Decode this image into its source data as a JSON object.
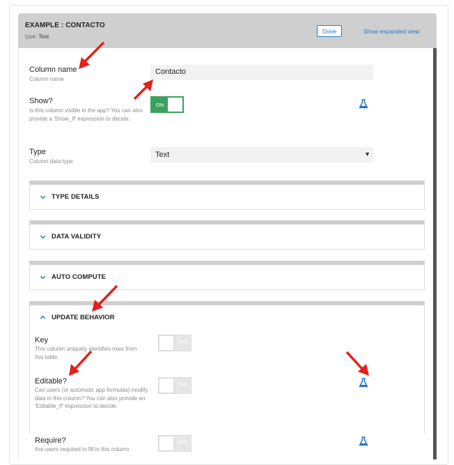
{
  "header": {
    "title": "EXAMPLE : CONTACTO",
    "type_prefix": "type:",
    "type_value": "Text",
    "done_label": "Done",
    "expand_label": "Show expanded view"
  },
  "fields": {
    "column_name": {
      "label": "Column name",
      "description": "Column name",
      "value": "Contacto"
    },
    "show": {
      "label": "Show?",
      "description": "Is this column visible in the app? You can also provide a 'Show_If' expression to decide.",
      "toggle_label": "ON"
    },
    "type": {
      "label": "Type",
      "description": "Column data type",
      "value": "Text"
    }
  },
  "sections": [
    {
      "title": "TYPE DETAILS"
    },
    {
      "title": "DATA VALIDITY"
    },
    {
      "title": "AUTO COMPUTE"
    },
    {
      "title": "UPDATE BEHAVIOR"
    }
  ],
  "update_behavior": {
    "key": {
      "label": "Key",
      "description": "This column uniquely identifies rows from this table.",
      "toggle_label": "OFF"
    },
    "editable": {
      "label": "Editable?",
      "description": "Can users (or automatic app formulas) modify data in this column? You can also provide an 'Editable_If' expression to decide.",
      "toggle_label": "OFF"
    },
    "require": {
      "label": "Require?",
      "description": "Are users required to fill in this column",
      "toggle_label": "OFF"
    }
  },
  "colors": {
    "accent_blue": "#2b78c2",
    "toggle_green": "#3aa15f",
    "annotation_red": "#e3201b"
  }
}
